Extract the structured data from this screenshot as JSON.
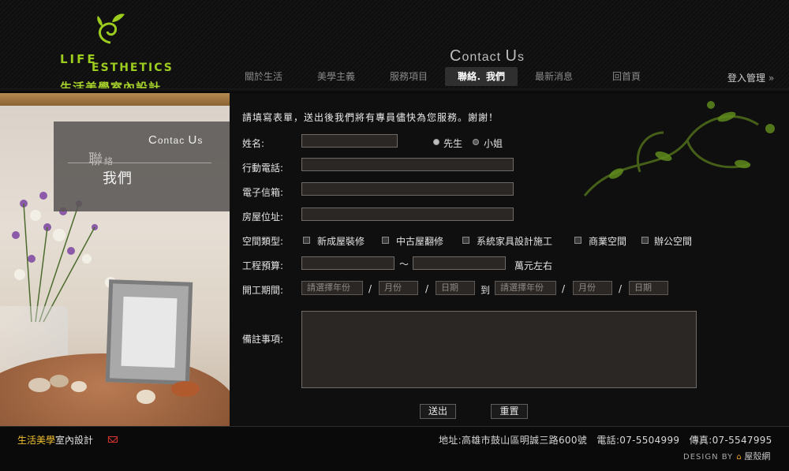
{
  "logo": {
    "en_line1": "LIFE",
    "en_line2": "ESTHETICS",
    "cn": "生活美學室內設計"
  },
  "page_heading": {
    "c": "C",
    "ontact": "ontact ",
    "u": "U",
    "s": "s"
  },
  "nav": {
    "items": [
      {
        "label": "關於生活"
      },
      {
        "label": "美學主義"
      },
      {
        "label": "服務項目"
      },
      {
        "label": "聯絡．我們"
      },
      {
        "label": "最新消息"
      },
      {
        "label": "回首頁"
      }
    ],
    "login": "登入管理",
    "login_arrow": "»"
  },
  "contact_box": {
    "en_c": "C",
    "en_ontact": "ontac ",
    "en_u": "U",
    "en_s": "s",
    "cn_a": "聯",
    "cn_b": "絡",
    "cn_line2": "我們"
  },
  "form": {
    "intro": "請填寫表單，送出後我們將有專員儘快為您服務。謝謝！",
    "name_label": "姓名:",
    "gender": [
      {
        "label": "先生",
        "checked": true
      },
      {
        "label": "小姐",
        "checked": false
      }
    ],
    "mobile_label": "行動電話:",
    "email_label": "電子信箱:",
    "address_label": "房屋位址:",
    "space_label": "空間類型:",
    "space_types": [
      "新成屋裝修",
      "中古屋翻修",
      "系統家具設計施工",
      "商業空間",
      "辦公空間"
    ],
    "budget_label": "工程預算:",
    "budget_sep": "～",
    "budget_unit": "萬元左右",
    "period_label": "開工期間:",
    "year_placeholder": "請選擇年份",
    "month_placeholder": "月份",
    "day_placeholder": "日期",
    "slash": "/",
    "to": "到",
    "notes_label": "備註事項:",
    "submit": "送出",
    "reset": "重置"
  },
  "footer": {
    "brand_a": "生活美學",
    "brand_b": "室內設計",
    "address": "地址:高雄市鼓山區明誠三路600號　電話:07-5504999　傳真:07-5547995",
    "design_by": "DESIGN BY",
    "designer": "屋殼網"
  },
  "colors": {
    "accent_green": "#9ccd1e",
    "footer_gold": "#f0c030"
  }
}
